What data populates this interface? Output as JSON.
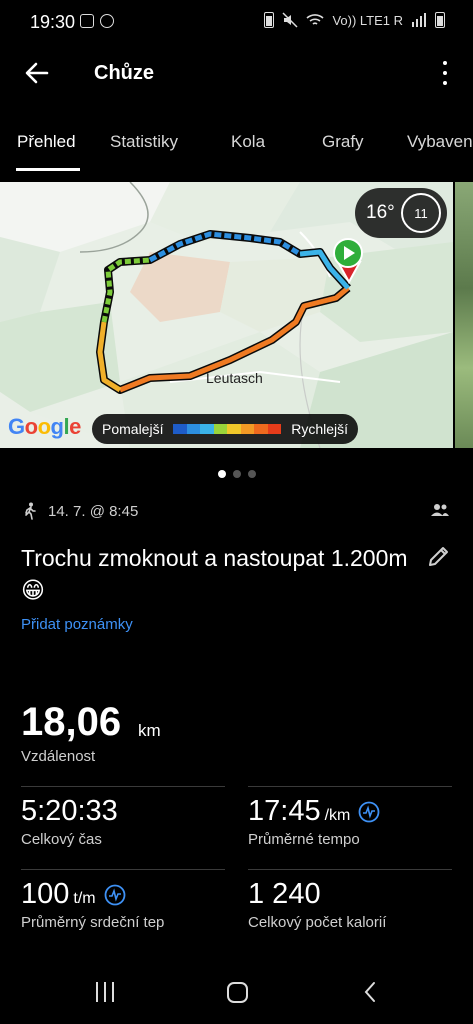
{
  "status_bar": {
    "time": "19:30",
    "network_label": "Vo)) LTE1 R"
  },
  "app_bar": {
    "title": "Chůze",
    "back_icon": "arrow-left-icon",
    "more_icon": "more-vertical-icon"
  },
  "tabs": [
    {
      "label": "Přehled",
      "active": true
    },
    {
      "label": "Statistiky",
      "active": false
    },
    {
      "label": "Kola",
      "active": false
    },
    {
      "label": "Grafy",
      "active": false
    },
    {
      "label": "Vybaven",
      "active": false
    }
  ],
  "map": {
    "place_label": "Leutasch",
    "weather": {
      "temperature": "16°",
      "uv_index": "11"
    },
    "attribution": "Google",
    "legend": {
      "slower": "Pomalejší",
      "faster": "Rychlejší",
      "colors": [
        "#1e5cc8",
        "#2d8fe0",
        "#3bb3e8",
        "#9ad43a",
        "#f0c82a",
        "#f39a25",
        "#ef6a1e",
        "#e63c1a"
      ]
    },
    "start_marker_color": "#2fae3a",
    "end_marker_color": "#d8232a"
  },
  "pager": {
    "count": 3,
    "active_index": 0
  },
  "activity": {
    "date_time": "14. 7. @ 8:45",
    "title": "Trochu zmoknout a nastoupat 1.200m😁",
    "add_note_label": "Přidat poznámky"
  },
  "stats": {
    "distance": {
      "value": "18,06",
      "unit": "km",
      "label": "Vzdálenost"
    },
    "total_time": {
      "value": "5:20:33",
      "label": "Celkový čas"
    },
    "avg_pace": {
      "value": "17:45",
      "unit": "/km",
      "label": "Průměrné tempo"
    },
    "avg_hr": {
      "value": "100",
      "unit": "t/m",
      "label": "Průměrný srdeční tep"
    },
    "calories": {
      "value": "1 240",
      "label": "Celkový počet kalorií"
    }
  },
  "colors": {
    "accent": "#3e91f5",
    "background": "#000000"
  }
}
